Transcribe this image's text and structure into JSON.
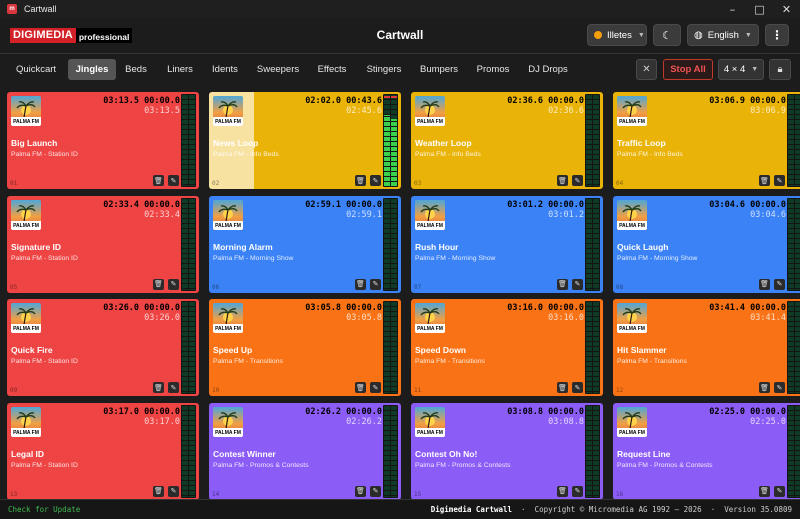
{
  "window": {
    "title": "Cartwall",
    "icon_label": "m",
    "controls": [
      "minimize",
      "maximize",
      "close"
    ]
  },
  "header": {
    "logo_main": "DIGIMEDIA",
    "logo_sub": "professional",
    "page_title": "Cartwall",
    "status_label": "Illetes",
    "status_color": "#f59e0b",
    "language": "English",
    "theme_icon": "moon-icon",
    "menu_icon": "kebab-menu-icon"
  },
  "tabs": [
    {
      "label": "Quickcart",
      "active": false
    },
    {
      "label": "Jingles",
      "active": true
    },
    {
      "label": "Beds",
      "active": false
    },
    {
      "label": "Liners",
      "active": false
    },
    {
      "label": "Idents",
      "active": false
    },
    {
      "label": "Sweepers",
      "active": false
    },
    {
      "label": "Effects",
      "active": false
    },
    {
      "label": "Stingers",
      "active": false
    },
    {
      "label": "Bumpers",
      "active": false
    },
    {
      "label": "Promos",
      "active": false
    },
    {
      "label": "DJ Drops",
      "active": false
    }
  ],
  "toolbar": {
    "stop_all": "Stop All",
    "grid_size": "4 × 4"
  },
  "station_badge": "PALMA FM",
  "carts": [
    {
      "num": "01",
      "title": "Big Launch",
      "subtitle": "Palma FM - Station ID",
      "duration": "03:13.5",
      "elapsed": "00:00.0",
      "remaining": "03:13.5",
      "color": "#ef4444",
      "progress": 0,
      "meter": [
        0,
        0
      ]
    },
    {
      "num": "02",
      "title": "News Loop",
      "subtitle": "Palma FM - Info Beds",
      "duration": "02:02.0",
      "elapsed": "00:43.6",
      "remaining": "02:45.6",
      "color": "#eab308",
      "progress": 0.26,
      "meter": [
        0.78,
        0.74
      ],
      "playing": true
    },
    {
      "num": "03",
      "title": "Weather Loop",
      "subtitle": "Palma FM - Info Beds",
      "duration": "02:36.6",
      "elapsed": "00:00.0",
      "remaining": "02:36.6",
      "color": "#eab308",
      "progress": 0,
      "meter": [
        0,
        0
      ]
    },
    {
      "num": "04",
      "title": "Traffic Loop",
      "subtitle": "Palma FM - Info Beds",
      "duration": "03:06.9",
      "elapsed": "00:00.0",
      "remaining": "03:06.9",
      "color": "#eab308",
      "progress": 0,
      "meter": [
        0,
        0
      ]
    },
    {
      "num": "05",
      "title": "Signature ID",
      "subtitle": "Palma FM - Station ID",
      "duration": "02:33.4",
      "elapsed": "00:00.0",
      "remaining": "02:33.4",
      "color": "#ef4444",
      "progress": 0,
      "meter": [
        0,
        0
      ]
    },
    {
      "num": "06",
      "title": "Morning Alarm",
      "subtitle": "Palma FM - Morning Show",
      "duration": "02:59.1",
      "elapsed": "00:00.0",
      "remaining": "02:59.1",
      "color": "#3b82f6",
      "progress": 0,
      "meter": [
        0,
        0
      ]
    },
    {
      "num": "07",
      "title": "Rush Hour",
      "subtitle": "Palma FM - Morning Show",
      "duration": "03:01.2",
      "elapsed": "00:00.0",
      "remaining": "03:01.2",
      "color": "#3b82f6",
      "progress": 0,
      "meter": [
        0,
        0
      ]
    },
    {
      "num": "08",
      "title": "Quick Laugh",
      "subtitle": "Palma FM - Morning Show",
      "duration": "03:04.6",
      "elapsed": "00:00.0",
      "remaining": "03:04.6",
      "color": "#3b82f6",
      "progress": 0,
      "meter": [
        0,
        0
      ]
    },
    {
      "num": "09",
      "title": "Quick Fire",
      "subtitle": "Palma FM - Station ID",
      "duration": "03:26.0",
      "elapsed": "00:00.0",
      "remaining": "03:26.0",
      "color": "#ef4444",
      "progress": 0,
      "meter": [
        0,
        0
      ]
    },
    {
      "num": "10",
      "title": "Speed Up",
      "subtitle": "Palma FM - Transitions",
      "duration": "03:05.8",
      "elapsed": "00:00.0",
      "remaining": "03:05.8",
      "color": "#f97316",
      "progress": 0,
      "meter": [
        0,
        0
      ]
    },
    {
      "num": "11",
      "title": "Speed Down",
      "subtitle": "Palma FM - Transitions",
      "duration": "03:16.0",
      "elapsed": "00:00.0",
      "remaining": "03:16.0",
      "color": "#f97316",
      "progress": 0,
      "meter": [
        0,
        0
      ]
    },
    {
      "num": "12",
      "title": "Hit Slammer",
      "subtitle": "Palma FM - Transitions",
      "duration": "03:41.4",
      "elapsed": "00:00.0",
      "remaining": "03:41.4",
      "color": "#f97316",
      "progress": 0,
      "meter": [
        0,
        0
      ]
    },
    {
      "num": "13",
      "title": "Legal ID",
      "subtitle": "Palma FM - Station ID",
      "duration": "03:17.0",
      "elapsed": "00:00.0",
      "remaining": "03:17.0",
      "color": "#ef4444",
      "progress": 0,
      "meter": [
        0,
        0
      ]
    },
    {
      "num": "14",
      "title": "Contest Winner",
      "subtitle": "Palma FM - Promos & Contests",
      "duration": "02:26.2",
      "elapsed": "00:00.0",
      "remaining": "02:26.2",
      "color": "#8b5cf6",
      "progress": 0,
      "meter": [
        0,
        0
      ]
    },
    {
      "num": "15",
      "title": "Contest Oh No!",
      "subtitle": "Palma FM - Promos & Contests",
      "duration": "03:08.8",
      "elapsed": "00:00.0",
      "remaining": "03:08.8",
      "color": "#8b5cf6",
      "progress": 0,
      "meter": [
        0,
        0
      ]
    },
    {
      "num": "16",
      "title": "Request Line",
      "subtitle": "Palma FM - Promos & Contests",
      "duration": "02:25.0",
      "elapsed": "00:00.0",
      "remaining": "02:25.0",
      "color": "#8b5cf6",
      "progress": 0,
      "meter": [
        0,
        0
      ]
    }
  ],
  "footer": {
    "update_link": "Check for Update",
    "app_name": "Digimedia Cartwall",
    "copyright": "Copyright © Micromedia AG 1992 – 2026",
    "version": "Version 35.0809"
  }
}
